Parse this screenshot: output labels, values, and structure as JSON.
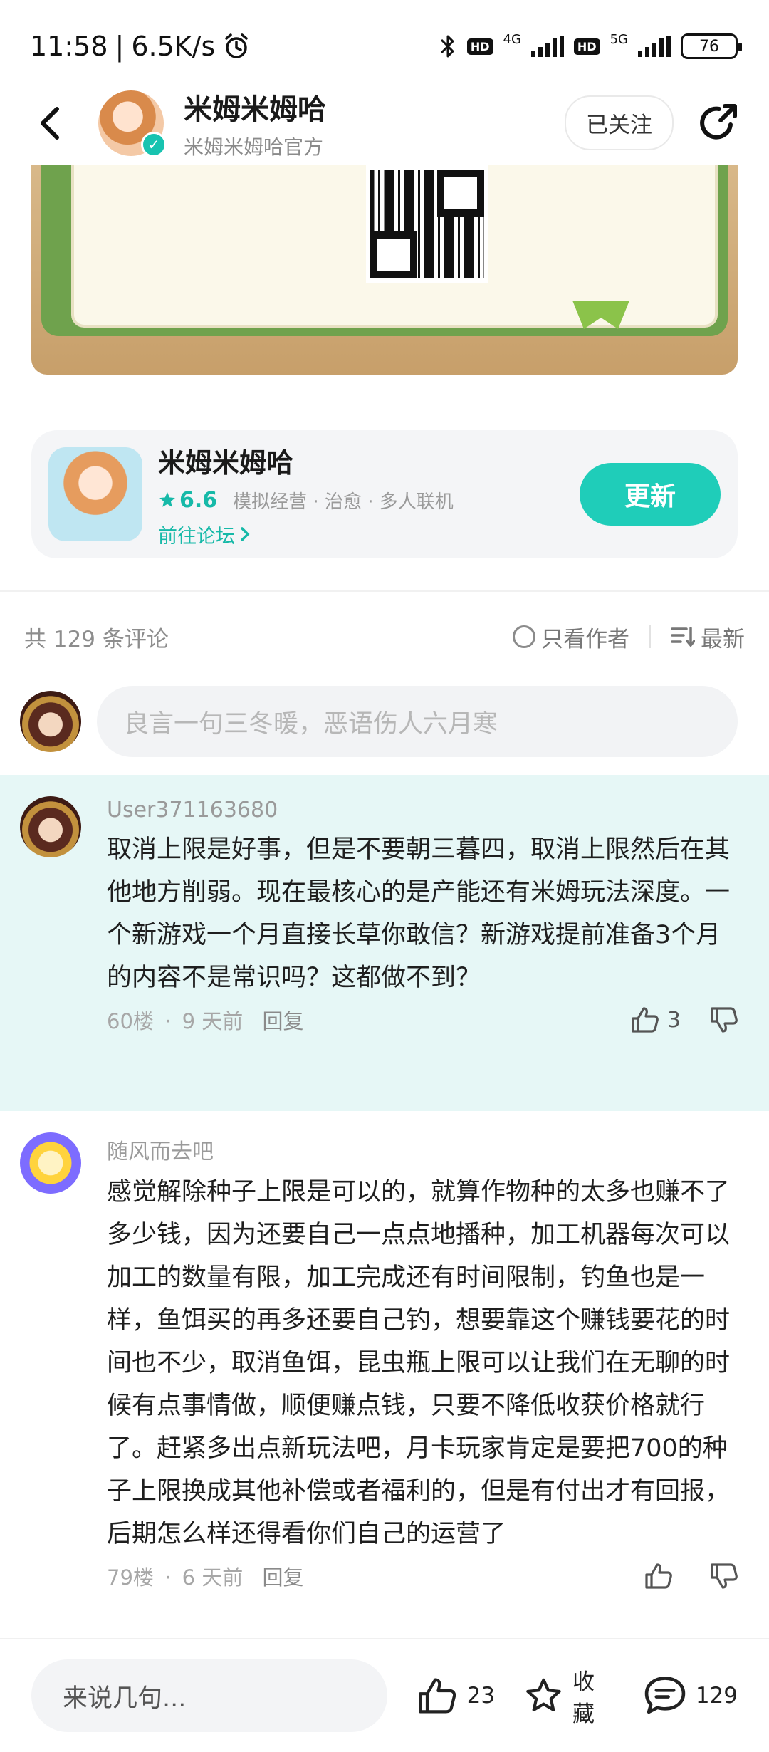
{
  "status_bar": {
    "time": "11:58",
    "separator": "|",
    "speed": "6.5K/s",
    "net1": "4G",
    "net2": "5G",
    "hd": "HD",
    "battery": "76"
  },
  "header": {
    "title": "米姆米姆哈",
    "subtitle": "米姆米姆哈官方",
    "follow_label": "已关注"
  },
  "app_card": {
    "name": "米姆米姆哈",
    "rating": "6.6",
    "tags": "模拟经营 · 治愈 · 多人联机",
    "forum_link": "前往论坛",
    "update_label": "更新"
  },
  "comments_header": {
    "count_label": "共 129 条评论",
    "author_only_label": "只看作者",
    "sort_label": "最新"
  },
  "composer": {
    "placeholder": "良言一句三冬暖，恶语伤人六月寒"
  },
  "comments": [
    {
      "user": "User371163680",
      "text": "取消上限是好事，但是不要朝三暮四，取消上限然后在其他地方削弱。现在最核心的是产能还有米姆玩法深度。一个新游戏一个月直接长草你敢信？新游戏提前准备3个月的内容不是常识吗？这都做不到？",
      "floor": "60楼",
      "time": "9 天前",
      "reply_label": "回复",
      "likes": "3"
    },
    {
      "user": "随风而去吧",
      "text": "感觉解除种子上限是可以的，就算作物种的太多也赚不了多少钱，因为还要自己一点点地播种，加工机器每次可以加工的数量有限，加工完成还有时间限制，钓鱼也是一样，鱼饵买的再多还要自己钓，想要靠这个赚钱要花的时间也不少，取消鱼饵，昆虫瓶上限可以让我们在无聊的时候有点事情做，顺便赚点钱，只要不降低收获价格就行了。赶紧多出点新玩法吧，月卡玩家肯定是要把700的种子上限换成其他补偿或者福利的，但是有付出才有回报，后期怎么样还得看你们自己的运营了",
      "floor": "79楼",
      "time": "6 天前",
      "reply_label": "回复",
      "likes": ""
    }
  ],
  "bottom_bar": {
    "input_placeholder": "来说几句...",
    "likes": "23",
    "favorite_label": "收藏",
    "comments": "129"
  },
  "colors": {
    "accent": "#1fcdb9",
    "highlight_bg": "#e6f7f6"
  }
}
